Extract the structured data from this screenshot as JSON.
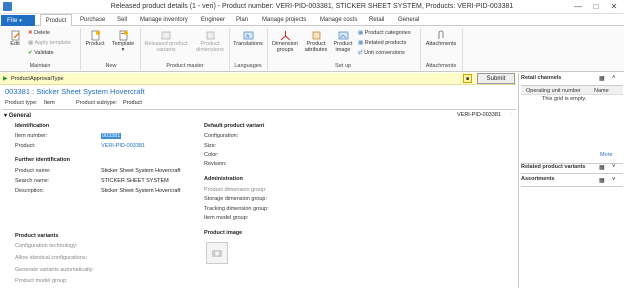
{
  "window": {
    "title": "Released product details (1 - veri) - Product number: VERI-PID-003381, STICKER SHEET SYSTEM, Products: VERI-PID-003381",
    "minimize": "—",
    "maximize": "□",
    "close": "✕"
  },
  "tabs": {
    "file": "File",
    "items": [
      "Product",
      "Purchase",
      "Sell",
      "Manage inventory",
      "Engineer",
      "Plan",
      "Manage projects",
      "Manage costs",
      "Retail",
      "General"
    ]
  },
  "ribbon": {
    "maintain": {
      "edit": "Edit",
      "delete": "Delete",
      "apply_template": "Apply template",
      "validate": "Validate",
      "group": "Maintain"
    },
    "new": {
      "product": "Product",
      "template": "Template",
      "group": "New"
    },
    "product_master": {
      "released_product_variants": "Released product variants",
      "product_dimensions": "Product dimensions",
      "group": "Product master"
    },
    "languages": {
      "translations": "Translations",
      "group": "Languages"
    },
    "setup": {
      "dimension_groups": "Dimension groups",
      "product_attributes": "Product attributes",
      "product_image": "Product image",
      "product_categories": "Product categories",
      "related_products": "Related products",
      "unit_conversions": "Unit conversions",
      "group": "Set up"
    },
    "attachments": {
      "attachments": "Attachments",
      "group": "Attachments"
    }
  },
  "infobar": {
    "text": "ProductApprovalType",
    "submit": "Submit"
  },
  "header": {
    "title": "003381 : Sticker Sheet System Hovercraft",
    "product_type_label": "Product type:",
    "product_type": "Item",
    "product_subtype_label": "Product subtype:",
    "product_subtype": "Product"
  },
  "general": {
    "section": "General",
    "record_id": "VERI-PID-003381",
    "identification": {
      "title": "Identification",
      "item_number_label": "Item number:",
      "item_number": "003381",
      "product_label": "Product:",
      "product": "VERI-PID-003381"
    },
    "further": {
      "title": "Further identification",
      "product_name_label": "Product name:",
      "product_name": "Sticker Sheet System Hovercraft",
      "search_name_label": "Search name:",
      "search_name": "STICKER SHEET SYSTEM",
      "description_label": "Description:",
      "description": "Sticker Sheet System Hovercraft"
    },
    "default_variant": {
      "title": "Default product variant",
      "configuration": "Configuration:",
      "size": "Size:",
      "color": "Color:",
      "revision": "Revision:"
    },
    "administration": {
      "title": "Administration",
      "product_dimension_group": "Product dimension group:",
      "storage_dimension_group": "Storage dimension group:",
      "tracking_dimension_group": "Tracking dimension group:",
      "item_model_group": "Item model group:"
    },
    "variants": {
      "title": "Product variants",
      "configuration_technology": "Configuration technology:",
      "allow_identical": "Allow identical configurations:",
      "generate_variants": "Generate variants automatically:",
      "product_model_group": "Product model group:"
    },
    "image": {
      "title": "Product image"
    }
  },
  "factboxes": {
    "retail_channels": "Retail channels",
    "col_operating_unit": "Operating unit number",
    "col_name": "Name",
    "empty": "This grid is empty.",
    "more": "More",
    "related_variants": "Related product variants",
    "assortments": "Assortments"
  },
  "colors": {
    "accent": "#1f6fc5",
    "infobar": "#fffcc8",
    "selection": "#3b8edc"
  }
}
